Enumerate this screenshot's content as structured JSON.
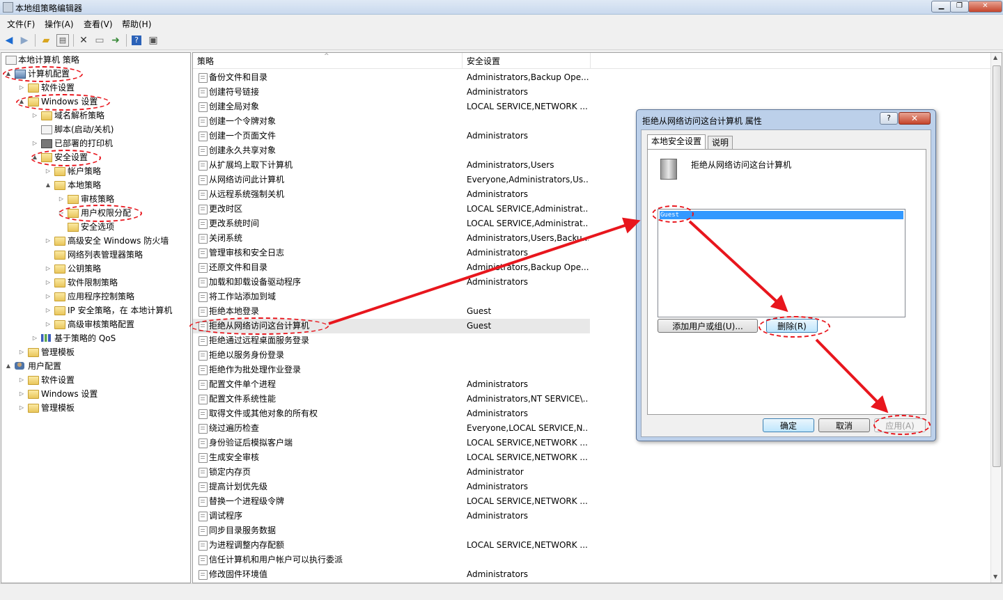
{
  "window": {
    "title": "本地组策略编辑器",
    "min": "▁",
    "max": "❐",
    "close": "✕"
  },
  "menu": {
    "items": [
      "文件(F)",
      "操作(A)",
      "查看(V)",
      "帮助(H)"
    ]
  },
  "toolbar": {
    "icons": [
      "back-icon",
      "forward-icon",
      "up-folder-icon",
      "show-tree-icon",
      "delete-icon",
      "properties-icon",
      "export-icon",
      "help-icon",
      "view-icon"
    ]
  },
  "tree": {
    "root": "本地计算机 策略",
    "items": [
      {
        "label": "计算机配置",
        "icon": "computer-icon",
        "depth": 0,
        "expander": "▲"
      },
      {
        "label": "软件设置",
        "icon": "folder-icon",
        "depth": 1,
        "expander": "▷"
      },
      {
        "label": "Windows 设置",
        "icon": "folder-icon",
        "depth": 1,
        "expander": "▲"
      },
      {
        "label": "域名解析策略",
        "icon": "folder-icon",
        "depth": 2,
        "expander": "▷"
      },
      {
        "label": "脚本(启动/关机)",
        "icon": "document-icon",
        "depth": 2,
        "expander": ""
      },
      {
        "label": "已部署的打印机",
        "icon": "printer-icon",
        "depth": 2,
        "expander": "▷"
      },
      {
        "label": "安全设置",
        "icon": "lock-folder-icon",
        "depth": 2,
        "expander": "▲"
      },
      {
        "label": "帐户策略",
        "icon": "folder-icon",
        "depth": 3,
        "expander": "▷"
      },
      {
        "label": "本地策略",
        "icon": "folder-icon",
        "depth": 3,
        "expander": "▲"
      },
      {
        "label": "审核策略",
        "icon": "lock-folder-icon",
        "depth": 4,
        "expander": "▷"
      },
      {
        "label": "用户权限分配",
        "icon": "lock-folder-icon",
        "depth": 4,
        "expander": "▷"
      },
      {
        "label": "安全选项",
        "icon": "lock-folder-icon",
        "depth": 4,
        "expander": ""
      },
      {
        "label": "高级安全 Windows 防火墙",
        "icon": "folder-icon",
        "depth": 3,
        "expander": "▷"
      },
      {
        "label": "网络列表管理器策略",
        "icon": "folder-icon",
        "depth": 3,
        "expander": ""
      },
      {
        "label": "公钥策略",
        "icon": "folder-icon",
        "depth": 3,
        "expander": "▷"
      },
      {
        "label": "软件限制策略",
        "icon": "folder-icon",
        "depth": 3,
        "expander": "▷"
      },
      {
        "label": "应用程序控制策略",
        "icon": "folder-icon",
        "depth": 3,
        "expander": "▷"
      },
      {
        "label": "IP 安全策略，在 本地计算机",
        "icon": "folder-icon",
        "depth": 3,
        "expander": "▷"
      },
      {
        "label": "高级审核策略配置",
        "icon": "folder-icon",
        "depth": 3,
        "expander": "▷"
      },
      {
        "label": "基于策略的 QoS",
        "icon": "chart-icon",
        "depth": 2,
        "expander": "▷"
      },
      {
        "label": "管理模板",
        "icon": "folder-icon",
        "depth": 1,
        "expander": "▷"
      },
      {
        "label": "用户配置",
        "icon": "user-icon",
        "depth": 0,
        "expander": "▲"
      },
      {
        "label": "软件设置",
        "icon": "folder-icon",
        "depth": 1,
        "expander": "▷"
      },
      {
        "label": "Windows 设置",
        "icon": "folder-icon",
        "depth": 1,
        "expander": "▷"
      },
      {
        "label": "管理模板",
        "icon": "folder-icon",
        "depth": 1,
        "expander": "▷"
      }
    ]
  },
  "list": {
    "columns": [
      "策略",
      "安全设置"
    ],
    "sort_indicator": "^",
    "rows": [
      {
        "name": "备份文件和目录",
        "value": "Administrators,Backup Ope..."
      },
      {
        "name": "创建符号链接",
        "value": "Administrators"
      },
      {
        "name": "创建全局对象",
        "value": "LOCAL SERVICE,NETWORK ..."
      },
      {
        "name": "创建一个令牌对象",
        "value": ""
      },
      {
        "name": "创建一个页面文件",
        "value": "Administrators"
      },
      {
        "name": "创建永久共享对象",
        "value": ""
      },
      {
        "name": "从扩展坞上取下计算机",
        "value": "Administrators,Users"
      },
      {
        "name": "从网络访问此计算机",
        "value": "Everyone,Administrators,Us..."
      },
      {
        "name": "从远程系统强制关机",
        "value": "Administrators"
      },
      {
        "name": "更改时区",
        "value": "LOCAL SERVICE,Administrat..."
      },
      {
        "name": "更改系统时间",
        "value": "LOCAL SERVICE,Administrat..."
      },
      {
        "name": "关闭系统",
        "value": "Administrators,Users,Backu..."
      },
      {
        "name": "管理审核和安全日志",
        "value": "Administrators"
      },
      {
        "name": "还原文件和目录",
        "value": "Administrators,Backup Ope..."
      },
      {
        "name": "加载和卸载设备驱动程序",
        "value": "Administrators"
      },
      {
        "name": "将工作站添加到域",
        "value": ""
      },
      {
        "name": "拒绝本地登录",
        "value": "Guest"
      },
      {
        "name": "拒绝从网络访问这台计算机",
        "value": "Guest"
      },
      {
        "name": "拒绝通过远程桌面服务登录",
        "value": ""
      },
      {
        "name": "拒绝以服务身份登录",
        "value": ""
      },
      {
        "name": "拒绝作为批处理作业登录",
        "value": ""
      },
      {
        "name": "配置文件单个进程",
        "value": "Administrators"
      },
      {
        "name": "配置文件系统性能",
        "value": "Administrators,NT SERVICE\\..."
      },
      {
        "name": "取得文件或其他对象的所有权",
        "value": "Administrators"
      },
      {
        "name": "绕过遍历检查",
        "value": "Everyone,LOCAL SERVICE,N..."
      },
      {
        "name": "身份验证后模拟客户端",
        "value": "LOCAL SERVICE,NETWORK ..."
      },
      {
        "name": "生成安全审核",
        "value": "LOCAL SERVICE,NETWORK ..."
      },
      {
        "name": "锁定内存页",
        "value": "Administrator"
      },
      {
        "name": "提高计划优先级",
        "value": "Administrators"
      },
      {
        "name": "替换一个进程级令牌",
        "value": "LOCAL SERVICE,NETWORK ..."
      },
      {
        "name": "调试程序",
        "value": "Administrators"
      },
      {
        "name": "同步目录服务数据",
        "value": ""
      },
      {
        "name": "为进程调整内存配额",
        "value": "LOCAL SERVICE,NETWORK ..."
      },
      {
        "name": "信任计算机和用户帐户可以执行委派",
        "value": ""
      },
      {
        "name": "修改固件环境值",
        "value": "Administrators"
      }
    ]
  },
  "dialog": {
    "title": "拒绝从网络访问这台计算机 属性",
    "help": "?",
    "close": "✕",
    "tabs": [
      "本地安全设置",
      "说明"
    ],
    "policy_name": "拒绝从网络访问这台计算机",
    "users": [
      "Guest"
    ],
    "add_button": "添加用户或组(U)...",
    "remove_button": "删除(R)",
    "ok_button": "确定",
    "cancel_button": "取消",
    "apply_button": "应用(A)"
  },
  "colors": {
    "annotation": "#e8161d",
    "selection": "#3399ff"
  }
}
